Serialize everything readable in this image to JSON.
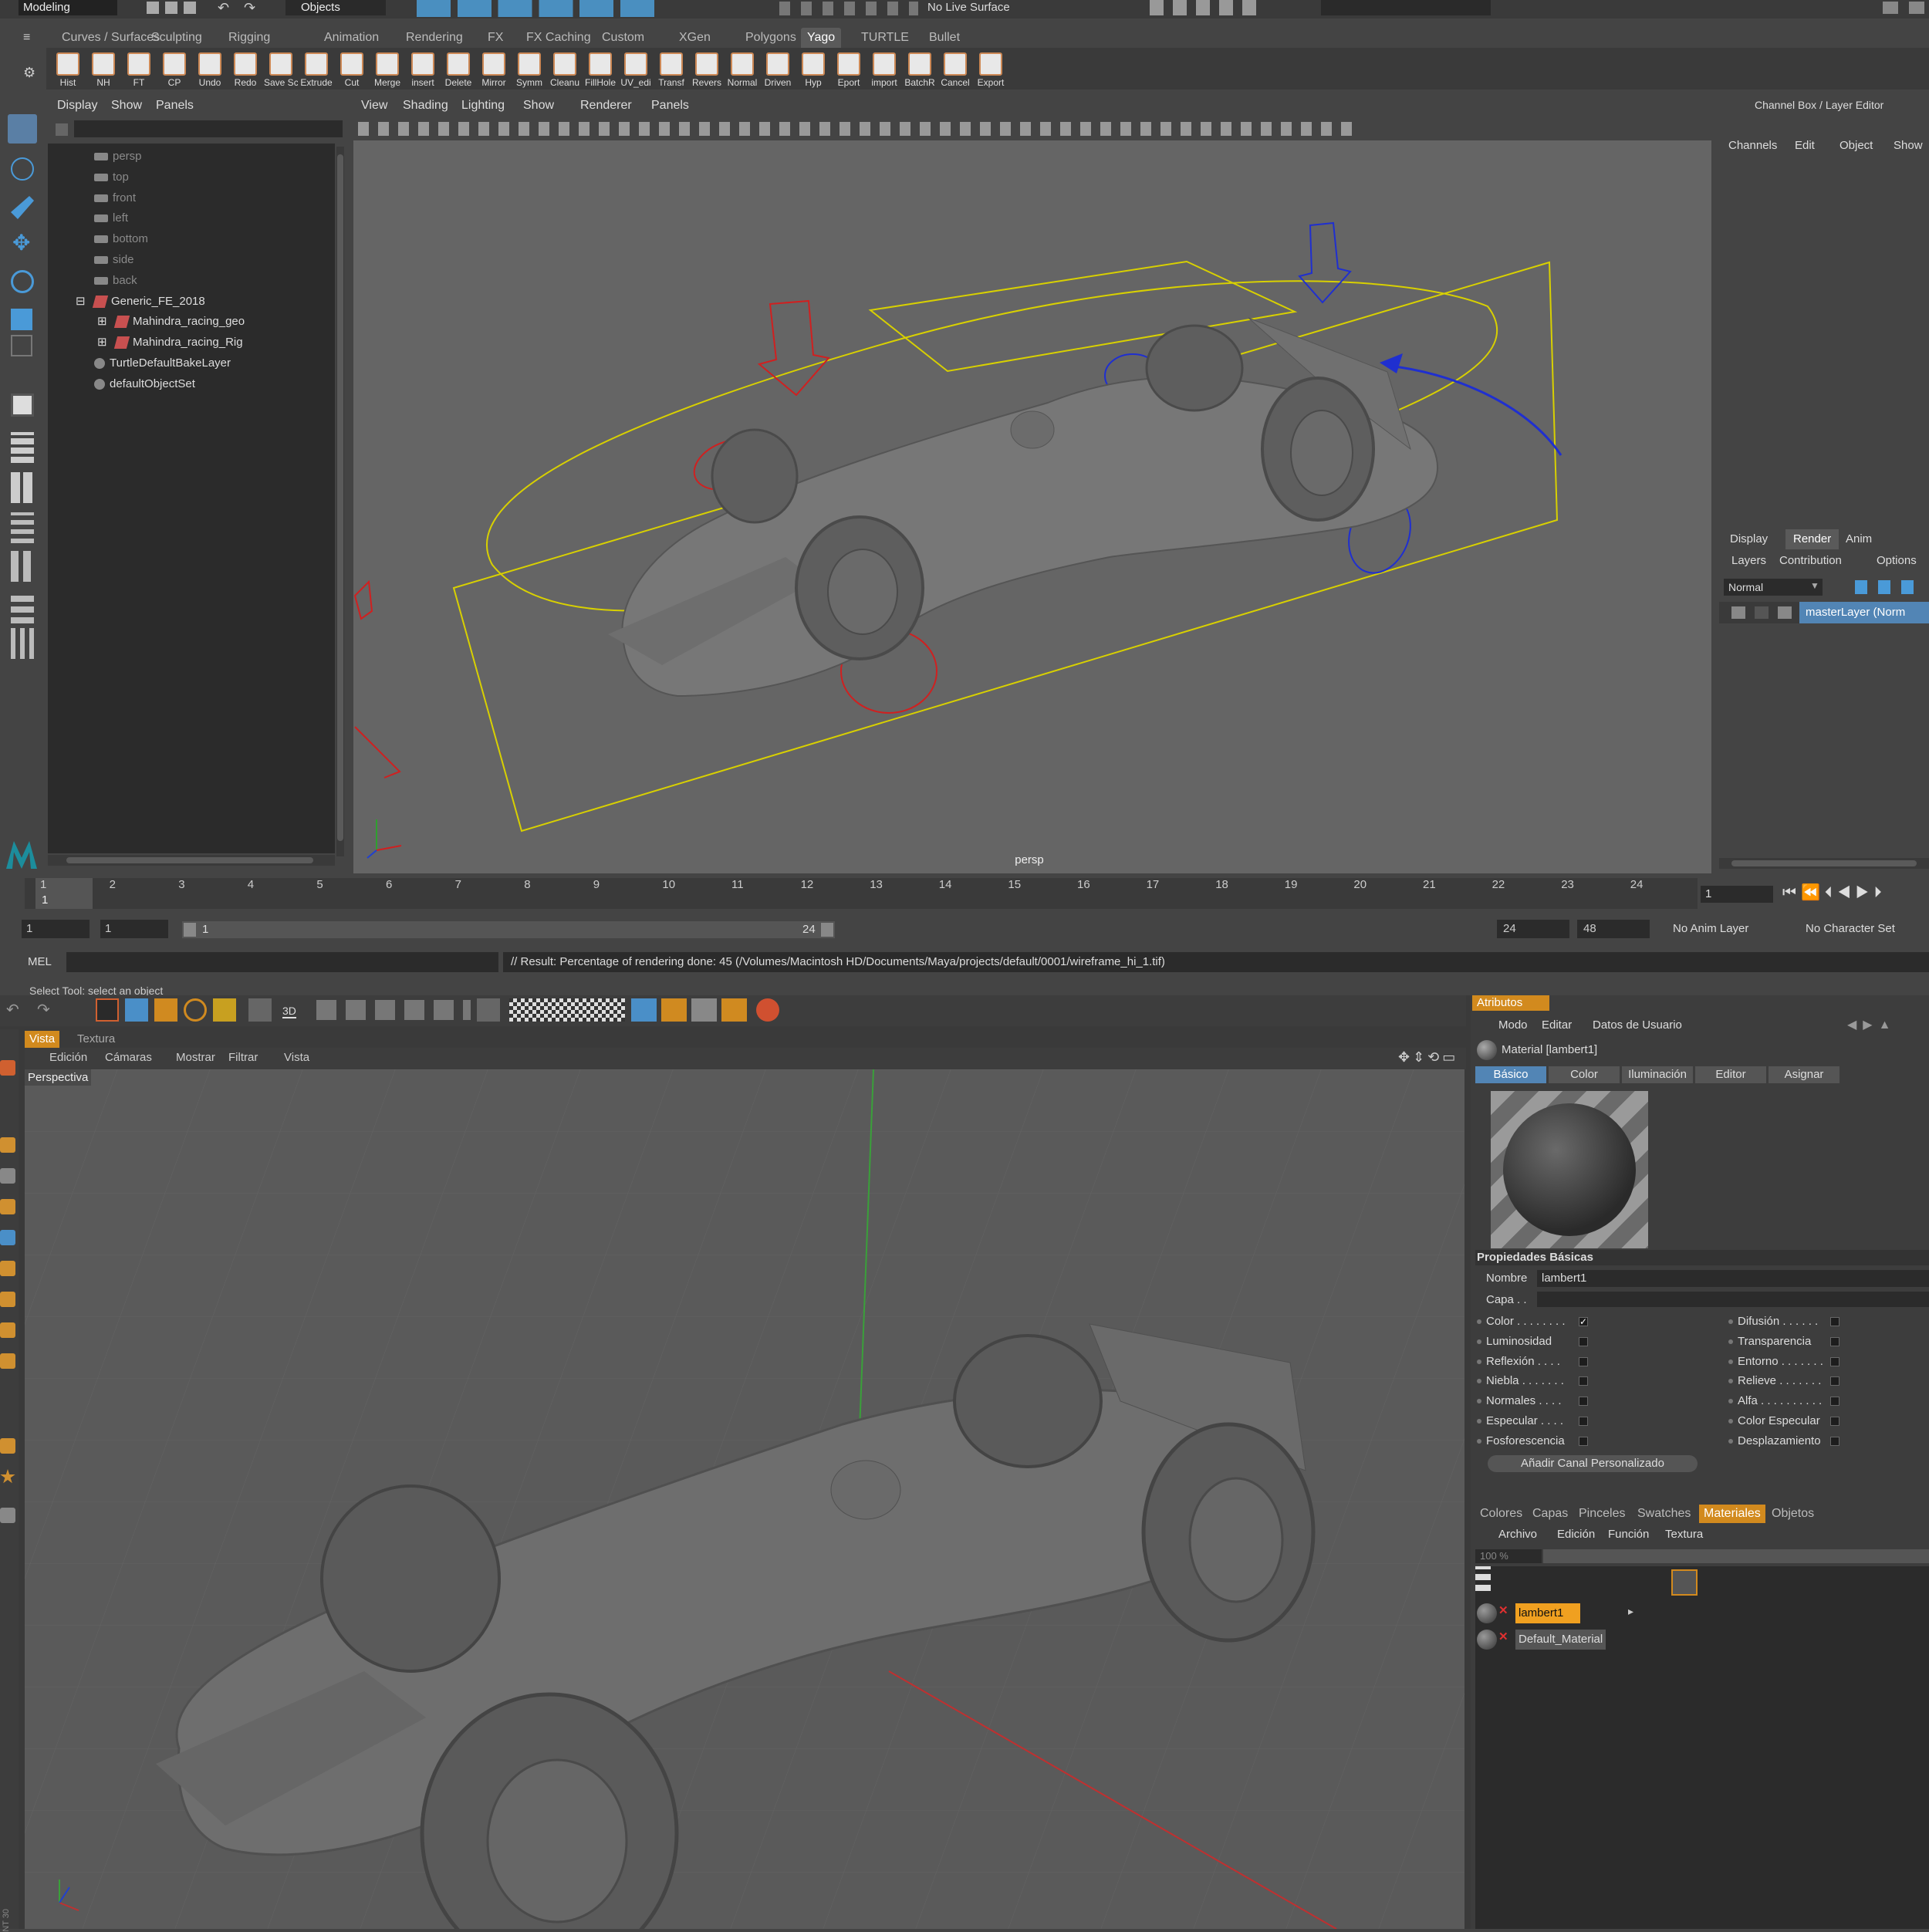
{
  "maya": {
    "status_line": {
      "mode": "Modeling",
      "select_mode": "Objects",
      "live_surface": "No Live Surface"
    },
    "shelf_tabs": [
      "Curves / Surfaces",
      "Sculpting",
      "Rigging",
      "Animation",
      "Rendering",
      "FX",
      "FX Caching",
      "Custom",
      "XGen",
      "Polygons",
      "Yago",
      "TURTLE",
      "Bullet"
    ],
    "active_shelf": "Yago",
    "shelf_buttons": [
      "Hist",
      "NH",
      "FT",
      "CP",
      "Undo",
      "Redo",
      "Save Sc",
      "Extrude",
      "Cut",
      "Merge",
      "insert",
      "Delete",
      "Mirror",
      "Symm",
      "Cleanu",
      "FillHole",
      "UV_edi",
      "Transf",
      "Revers",
      "Normal",
      "Driven",
      "Hyp",
      "Eport",
      "import",
      "BatchR",
      "Cancel",
      "Export"
    ],
    "outliner": {
      "menu": [
        "Display",
        "Show",
        "Panels"
      ],
      "items": [
        {
          "label": "persp",
          "dim": true
        },
        {
          "label": "top",
          "dim": true
        },
        {
          "label": "front",
          "dim": true
        },
        {
          "label": "left",
          "dim": true
        },
        {
          "label": "bottom",
          "dim": true
        },
        {
          "label": "side",
          "dim": true
        },
        {
          "label": "back",
          "dim": true
        },
        {
          "label": "Generic_FE_2018",
          "dim": false
        },
        {
          "label": "Mahindra_racing_geo",
          "dim": false
        },
        {
          "label": "Mahindra_racing_Rig",
          "dim": false
        },
        {
          "label": "TurtleDefaultBakeLayer",
          "dim": false
        },
        {
          "label": "defaultObjectSet",
          "dim": false
        }
      ]
    },
    "viewport": {
      "menu": [
        "View",
        "Shading",
        "Lighting",
        "Show",
        "Renderer",
        "Panels"
      ],
      "camera_label": "persp"
    },
    "channel_box": {
      "title": "Channel Box / Layer Editor",
      "menu": [
        "Channels",
        "Edit",
        "Object",
        "Show"
      ],
      "layer_tabs": [
        "Display",
        "Render",
        "Anim"
      ],
      "active_layer_tab": "Render",
      "layer_menu": [
        "Layers",
        "Contribution",
        "Options"
      ],
      "blend_mode": "Normal",
      "layer_name": "masterLayer (Norm"
    },
    "timeline": {
      "ticks": [
        "1",
        "2",
        "3",
        "4",
        "5",
        "6",
        "7",
        "8",
        "9",
        "10",
        "11",
        "12",
        "13",
        "14",
        "15",
        "16",
        "17",
        "18",
        "19",
        "20",
        "21",
        "22",
        "23",
        "24"
      ],
      "current_frame": "1",
      "frame_field": "1"
    },
    "range": {
      "start": "1",
      "start2": "1",
      "slider_start": "1",
      "slider_end": "24",
      "end": "24",
      "end2": "48",
      "anim_layer": "No Anim Layer",
      "char_set": "No Character Set"
    },
    "command_line": {
      "label": "MEL",
      "result": "// Result: Percentage of rendering done: 45 (/Volumes/Macintosh HD/Documents/Maya/projects/default/0001/wireframe_hi_1.tif)"
    },
    "help_line": "Select Tool: select an object"
  },
  "c4d": {
    "view_tabs": [
      "Vista",
      "Textura"
    ],
    "view_menu": [
      "Edición",
      "Cámaras",
      "Mostrar",
      "Filtrar",
      "Vista"
    ],
    "view_label": "Perspectiva",
    "attributes": {
      "header": "Atributos",
      "menu": [
        "Modo",
        "Editar",
        "Datos de Usuario"
      ],
      "material_title": "Material [lambert1]",
      "tabs": [
        "Básico",
        "Color",
        "Iluminación",
        "Editor",
        "Asignar"
      ],
      "active_tab": "Básico",
      "section": "Propiedades Básicas",
      "name_label": "Nombre",
      "name_value": "lambert1",
      "layer_label": "Capa . .",
      "channels_left": [
        {
          "label": "Color . . . . . . . .",
          "checked": true
        },
        {
          "label": "Luminosidad",
          "checked": false
        },
        {
          "label": "Reflexión . . . .",
          "checked": false
        },
        {
          "label": "Niebla . . . . . . .",
          "checked": false
        },
        {
          "label": "Normales . . . .",
          "checked": false
        },
        {
          "label": "Especular . . . .",
          "checked": false
        },
        {
          "label": "Fosforescencia",
          "checked": false
        }
      ],
      "channels_right": [
        {
          "label": "Difusión . . . . . .",
          "checked": false
        },
        {
          "label": "Transparencia",
          "checked": false
        },
        {
          "label": "Entorno . . . . . . .",
          "checked": false
        },
        {
          "label": "Relieve . . . . . . .",
          "checked": false
        },
        {
          "label": "Alfa . . . . . . . . . .",
          "checked": false
        },
        {
          "label": "Color Especular",
          "checked": false
        },
        {
          "label": "Desplazamiento",
          "checked": false
        }
      ],
      "add_channel": "Añadir Canal Personalizado"
    },
    "materials": {
      "tabs": [
        "Colores",
        "Capas",
        "Pinceles",
        "Swatches",
        "Materiales",
        "Objetos"
      ],
      "active_tab": "Materiales",
      "menu": [
        "Archivo",
        "Edición",
        "Función",
        "Textura"
      ],
      "zoom": "100 %",
      "items": [
        "lambert1",
        "Default_Material"
      ]
    },
    "left_vertical_label": "NT 30"
  }
}
